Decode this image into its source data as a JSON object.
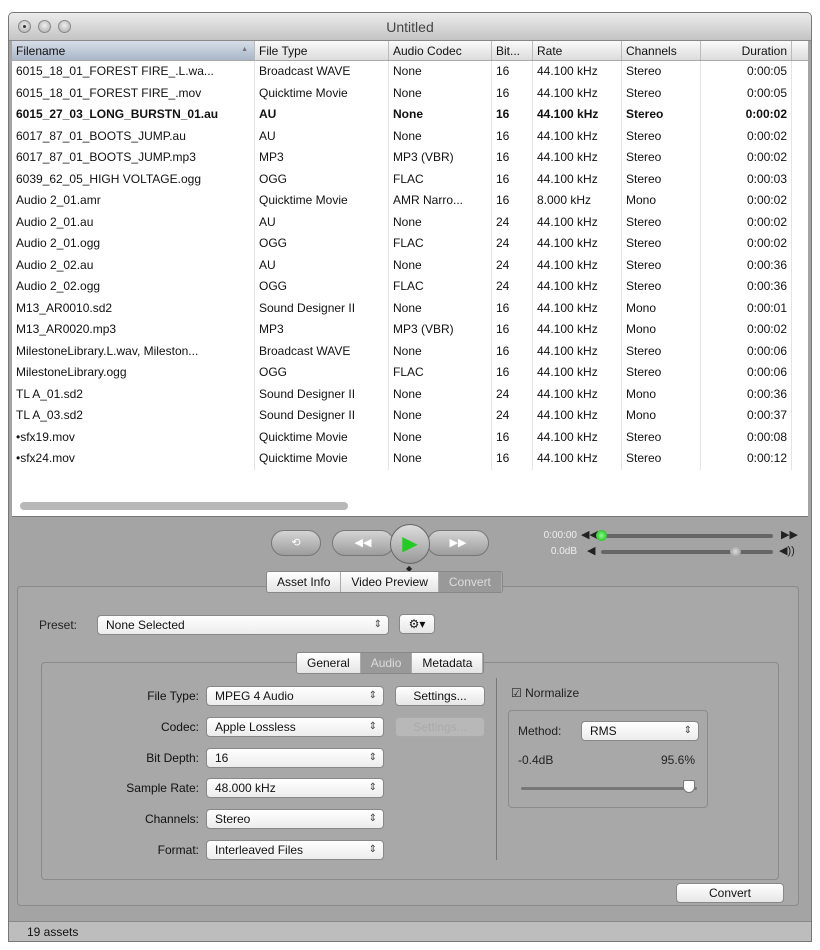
{
  "window": {
    "title": "Untitled"
  },
  "table": {
    "columns": [
      "Filename",
      "File Type",
      "Audio Codec",
      "Bit...",
      "Rate",
      "Channels",
      "Duration"
    ],
    "rows": [
      [
        "6015_18_01_FOREST FIRE_.L.wa...",
        "Broadcast WAVE",
        "None",
        "16",
        "44.100 kHz",
        "Stereo",
        "0:00:05"
      ],
      [
        "6015_18_01_FOREST FIRE_.mov",
        "Quicktime Movie",
        "None",
        "16",
        "44.100 kHz",
        "Stereo",
        "0:00:05"
      ],
      [
        "6015_27_03_LONG_BURSTN_01.au",
        "AU",
        "None",
        "16",
        "44.100 kHz",
        "Stereo",
        "0:00:02"
      ],
      [
        "6017_87_01_BOOTS_JUMP.au",
        "AU",
        "None",
        "16",
        "44.100 kHz",
        "Stereo",
        "0:00:02"
      ],
      [
        "6017_87_01_BOOTS_JUMP.mp3",
        "MP3",
        "MP3 (VBR)",
        "16",
        "44.100 kHz",
        "Stereo",
        "0:00:02"
      ],
      [
        "6039_62_05_HIGH VOLTAGE.ogg",
        "OGG",
        "FLAC",
        "16",
        "44.100 kHz",
        "Stereo",
        "0:00:03"
      ],
      [
        "Audio 2_01.amr",
        "Quicktime Movie",
        "AMR Narro...",
        "16",
        "8.000 kHz",
        "Mono",
        "0:00:02"
      ],
      [
        "Audio 2_01.au",
        "AU",
        "None",
        "24",
        "44.100 kHz",
        "Stereo",
        "0:00:02"
      ],
      [
        "Audio 2_01.ogg",
        "OGG",
        "FLAC",
        "24",
        "44.100 kHz",
        "Stereo",
        "0:00:02"
      ],
      [
        "Audio 2_02.au",
        "AU",
        "None",
        "24",
        "44.100 kHz",
        "Stereo",
        "0:00:36"
      ],
      [
        "Audio 2_02.ogg",
        "OGG",
        "FLAC",
        "24",
        "44.100 kHz",
        "Stereo",
        "0:00:36"
      ],
      [
        "M13_AR0010.sd2",
        "Sound Designer II",
        "None",
        "16",
        "44.100 kHz",
        "Mono",
        "0:00:01"
      ],
      [
        "M13_AR0020.mp3",
        "MP3",
        "MP3 (VBR)",
        "16",
        "44.100 kHz",
        "Mono",
        "0:00:02"
      ],
      [
        "MilestoneLibrary.L.wav, Mileston...",
        "Broadcast WAVE",
        "None",
        "16",
        "44.100 kHz",
        "Stereo",
        "0:00:06"
      ],
      [
        "MilestoneLibrary.ogg",
        "OGG",
        "FLAC",
        "16",
        "44.100 kHz",
        "Stereo",
        "0:00:06"
      ],
      [
        "TL A_01.sd2",
        "Sound Designer II",
        "None",
        "24",
        "44.100 kHz",
        "Mono",
        "0:00:36"
      ],
      [
        "TL A_03.sd2",
        "Sound Designer II",
        "None",
        "24",
        "44.100 kHz",
        "Mono",
        "0:00:37"
      ],
      [
        "•sfx19.mov",
        "Quicktime Movie",
        "None",
        "16",
        "44.100 kHz",
        "Stereo",
        "0:00:08"
      ],
      [
        "•sfx24.mov",
        "Quicktime Movie",
        "None",
        "16",
        "44.100 kHz",
        "Stereo",
        "0:00:12"
      ]
    ],
    "bold_row": 2
  },
  "player": {
    "time": "0:00:00",
    "volume": "0.0dB",
    "position": 0,
    "volume_level": 0.78
  },
  "tabs": [
    "Asset Info",
    "Video Preview",
    "Convert"
  ],
  "preset": {
    "label": "Preset:",
    "value": "None Selected"
  },
  "subtabs": [
    "General",
    "Audio",
    "Metadata"
  ],
  "audio": {
    "fields": [
      {
        "label": "File Type:",
        "value": "MPEG 4 Audio"
      },
      {
        "label": "Codec:",
        "value": "Apple Lossless"
      },
      {
        "label": "Bit Depth:",
        "value": "16"
      },
      {
        "label": "Sample Rate:",
        "value": "48.000 kHz"
      },
      {
        "label": "Channels:",
        "value": "Stereo"
      },
      {
        "label": "Format:",
        "value": "Interleaved Files"
      }
    ],
    "settings1": "Settings...",
    "settings2": "Settings...",
    "normalize": "Normalize",
    "method_label": "Method:",
    "method": "RMS",
    "db": "-0.4dB",
    "percent": "95.6%",
    "level": 0.956
  },
  "convert": "Convert",
  "status": "19 assets"
}
